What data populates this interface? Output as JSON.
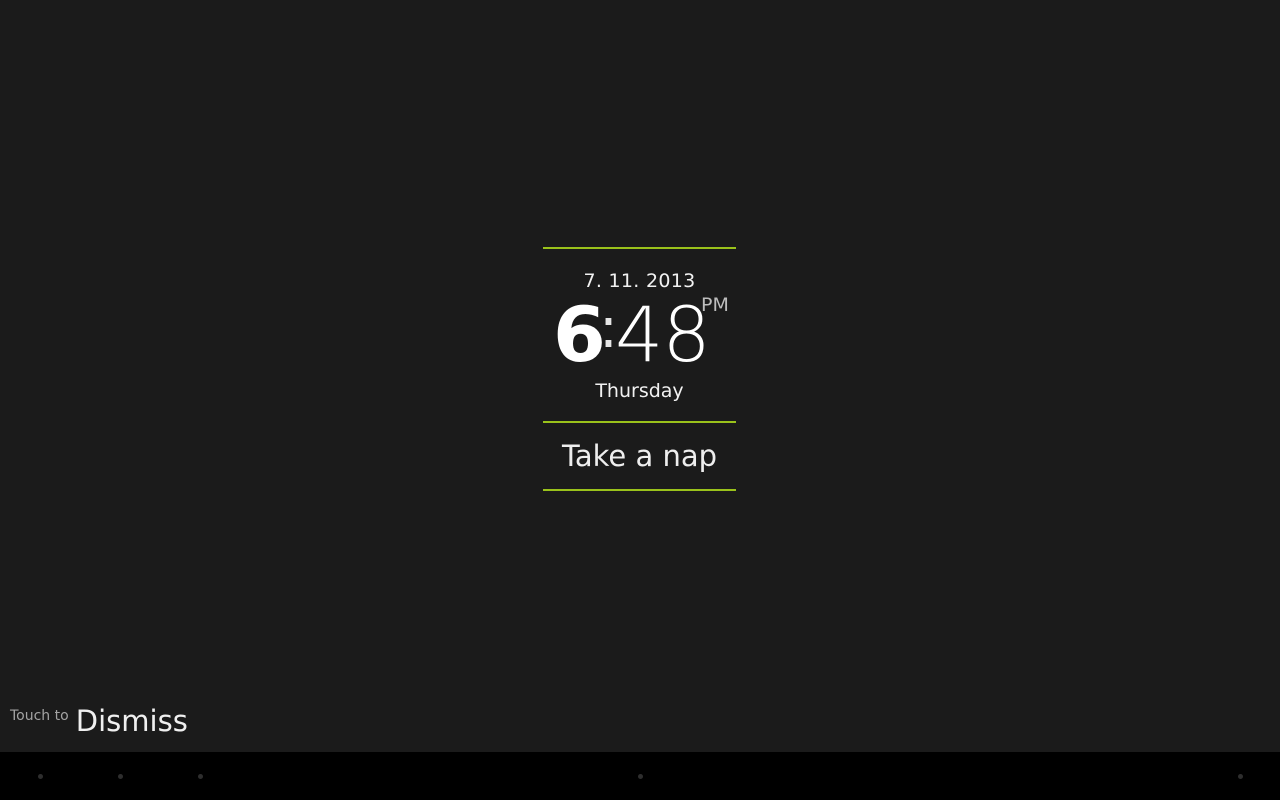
{
  "alarm": {
    "date": "7. 11. 2013",
    "time_hour": "6",
    "time_separator": ":",
    "time_minutes": "48",
    "ampm": "PM",
    "day": "Thursday",
    "nap_label": "Take a nap"
  },
  "dismiss": {
    "prefix": "Touch to",
    "label": "Dismiss"
  },
  "navbar": {
    "buttons": [
      "back-button",
      "home-button",
      "recents-button",
      "menu-dot",
      "notification-dot"
    ]
  },
  "colors": {
    "background": "#1b1b1b",
    "accent": "#9ac21b",
    "navbar": "#000000"
  }
}
